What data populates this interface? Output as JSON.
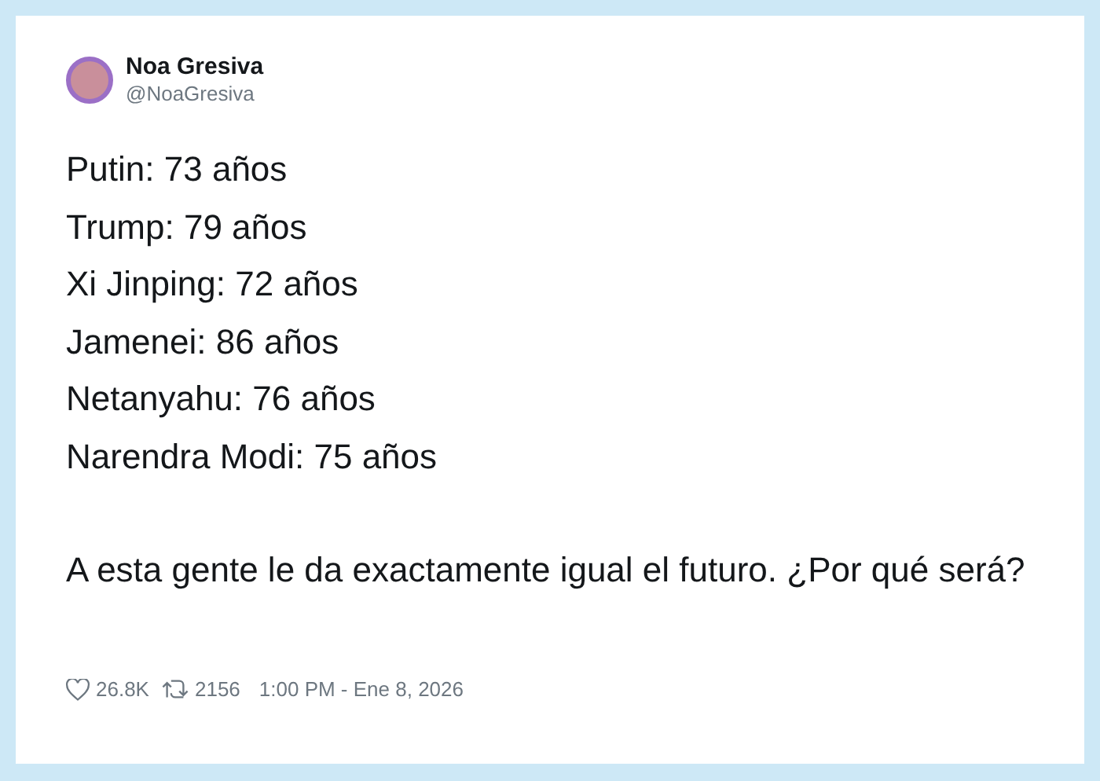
{
  "author": {
    "name": "Noa Gresiva",
    "handle": "@NoaGresiva"
  },
  "lines": [
    "Putin: 73 años",
    "Trump: 79 años",
    "Xi Jinping: 72 años",
    "Jamenei: 86 años",
    "Netanyahu: 76 años",
    "Narendra Modi: 75 años"
  ],
  "comment": "A esta gente le da exactamente igual el futuro. ¿Por qué será?",
  "footer": {
    "likes": "26.8K",
    "retweets": "2156",
    "timestamp": "1:00 PM - Ene 8, 2026"
  }
}
